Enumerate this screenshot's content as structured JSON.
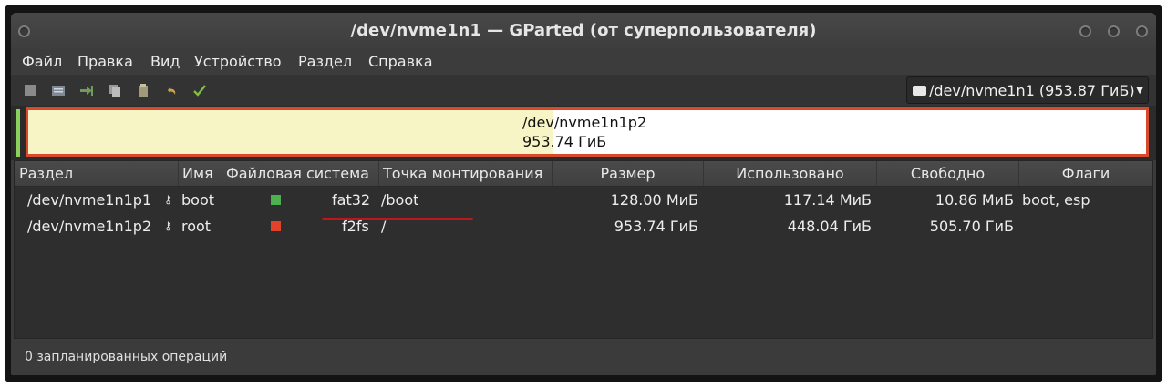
{
  "window": {
    "title": "/dev/nvme1n1 — GParted (от суперпользователя)"
  },
  "menu": [
    "Файл",
    "Правка",
    "Вид",
    "Устройство",
    "Раздел",
    "Справка"
  ],
  "toolbar": {
    "icons": [
      "new-partition-icon",
      "resize-move-icon",
      "copy-icon",
      "paste-icon",
      "undo-icon",
      "apply-icon",
      "delete-icon"
    ],
    "device_selector": "/dev/nvme1n1 (953.87 ГиБ)"
  },
  "partition_bar": {
    "name": "/dev/nvme1n1p2",
    "size": "953.74 ГиБ"
  },
  "table": {
    "columns": [
      "Раздел",
      "Имя",
      "Файловая система",
      "Точка монтирования",
      "Размер",
      "Использовано",
      "Свободно",
      "Флаги"
    ],
    "rows": [
      {
        "partition": "/dev/nvme1n1p1",
        "key_icon": "⚷",
        "name": "boot",
        "fs_color": "#4caf50",
        "fs": "fat32",
        "mount": "/boot",
        "size": "128.00 МиБ",
        "used": "117.14 МиБ",
        "free": "10.86 МиБ",
        "flags": "boot, esp"
      },
      {
        "partition": "/dev/nvme1n1p2",
        "key_icon": "⚷",
        "name": "root",
        "fs_color": "#e0432a",
        "fs": "f2fs",
        "mount": "/",
        "size": "953.74 ГиБ",
        "used": "448.04 ГиБ",
        "free": "505.70 ГиБ",
        "flags": ""
      }
    ]
  },
  "status": "0 запланированных операций"
}
